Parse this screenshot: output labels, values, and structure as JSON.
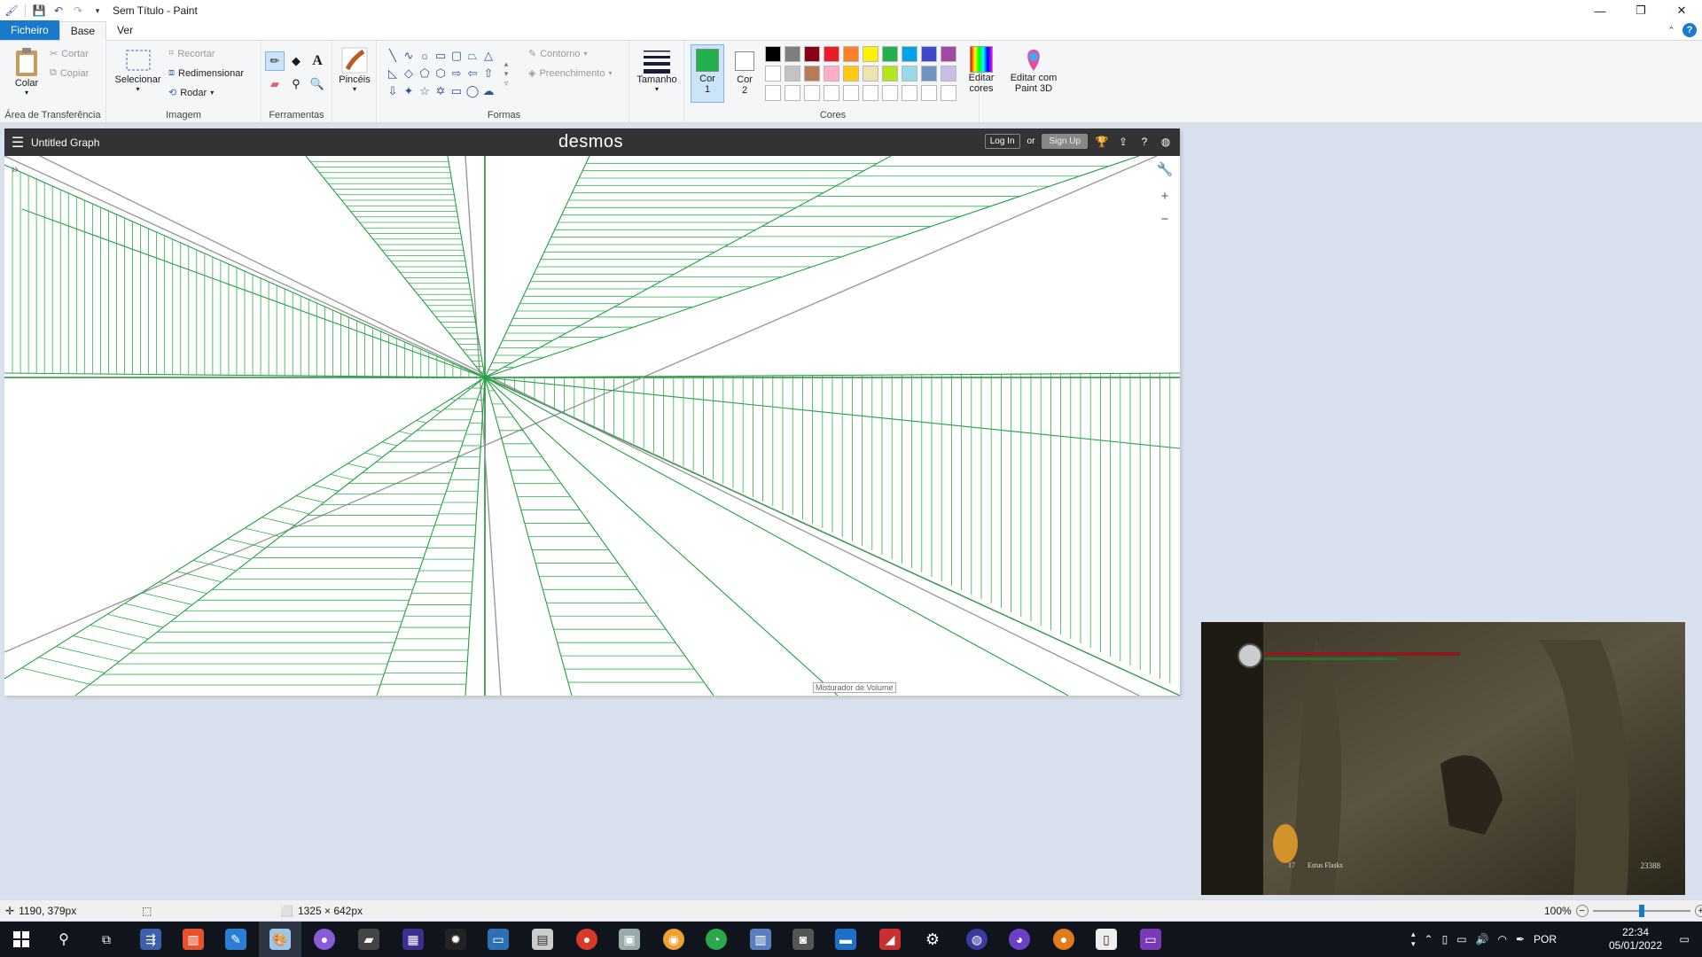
{
  "window": {
    "title": "Sem Título - Paint",
    "minimize": "—",
    "restore": "❐",
    "close": "✕"
  },
  "tabs": [
    {
      "label": "Ficheiro"
    },
    {
      "label": "Base"
    },
    {
      "label": "Ver"
    }
  ],
  "ribbon": {
    "clipboard": {
      "paste": "Colar",
      "cut": "Cortar",
      "copy": "Copiar",
      "label": "Área de Transferência"
    },
    "image": {
      "select": "Selecionar",
      "crop": "Recortar",
      "resize": "Redimensionar",
      "rotate": "Rodar",
      "label": "Imagem"
    },
    "tools": {
      "label": "Ferramentas"
    },
    "brushes": {
      "label": "Pincéis"
    },
    "shapes": {
      "outline": "Contorno",
      "fill": "Preenchimento",
      "label": "Formas"
    },
    "size": {
      "label": "Tamanho"
    },
    "color1": {
      "label_line1": "Cor",
      "label_line2": "1",
      "value": "#22b14c"
    },
    "color2": {
      "label_line1": "Cor",
      "label_line2": "2",
      "value": "#ffffff"
    },
    "colors": {
      "label": "Cores",
      "row1": [
        "#000000",
        "#7f7f7f",
        "#880015",
        "#ed1c24",
        "#ff7f27",
        "#fff200",
        "#22b14c",
        "#00a2e8",
        "#3f48cc",
        "#a349a4"
      ],
      "row2": [
        "#ffffff",
        "#c3c3c3",
        "#b97a57",
        "#ffaec9",
        "#ffc90e",
        "#efe4b0",
        "#b5e61d",
        "#99d9ea",
        "#7092be",
        "#c8bfe7"
      ],
      "row3": [
        "#ffffff",
        "#ffffff",
        "#ffffff",
        "#ffffff",
        "#ffffff",
        "#ffffff",
        "#ffffff",
        "#ffffff",
        "#ffffff",
        "#ffffff"
      ]
    },
    "edit_colors": {
      "line1": "Editar",
      "line2": "cores"
    },
    "paint3d": {
      "line1": "Editar com",
      "line2": "Paint 3D"
    }
  },
  "desmos": {
    "graph_title": "Untitled Graph",
    "logo": "desmos",
    "login": "Log In",
    "or": "or",
    "signup": "Sign Up",
    "tooltip": "Misturador de Volume"
  },
  "game_hud": {
    "estus_count": "17",
    "estus_label": "Estus Flasks",
    "souls": "23388"
  },
  "status": {
    "cursor": "1190, 379px",
    "size": "1325 × 642px",
    "zoom": "100%",
    "zoom_level": 0.5
  },
  "taskbar": {
    "lang": "POR",
    "time": "22:34",
    "date": "05/01/2022"
  }
}
